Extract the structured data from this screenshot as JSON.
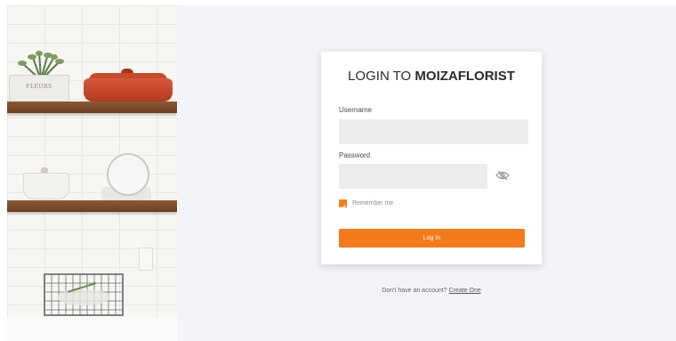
{
  "decor": {
    "pot_label": "FLEURS",
    "accent_color": "#f37a1d"
  },
  "login": {
    "title_prefix": "LOGIN TO ",
    "title_brand": "MOIZAFLORIST",
    "username_label": "Username",
    "username_value": "",
    "password_label": "Password",
    "password_value": "",
    "toggle_icon": "eye-slash-icon",
    "remember_label": "Remember me",
    "remember_checked": true,
    "submit_label": "Log In"
  },
  "footer": {
    "prompt": "Don't have an account?",
    "link": "Create One"
  }
}
